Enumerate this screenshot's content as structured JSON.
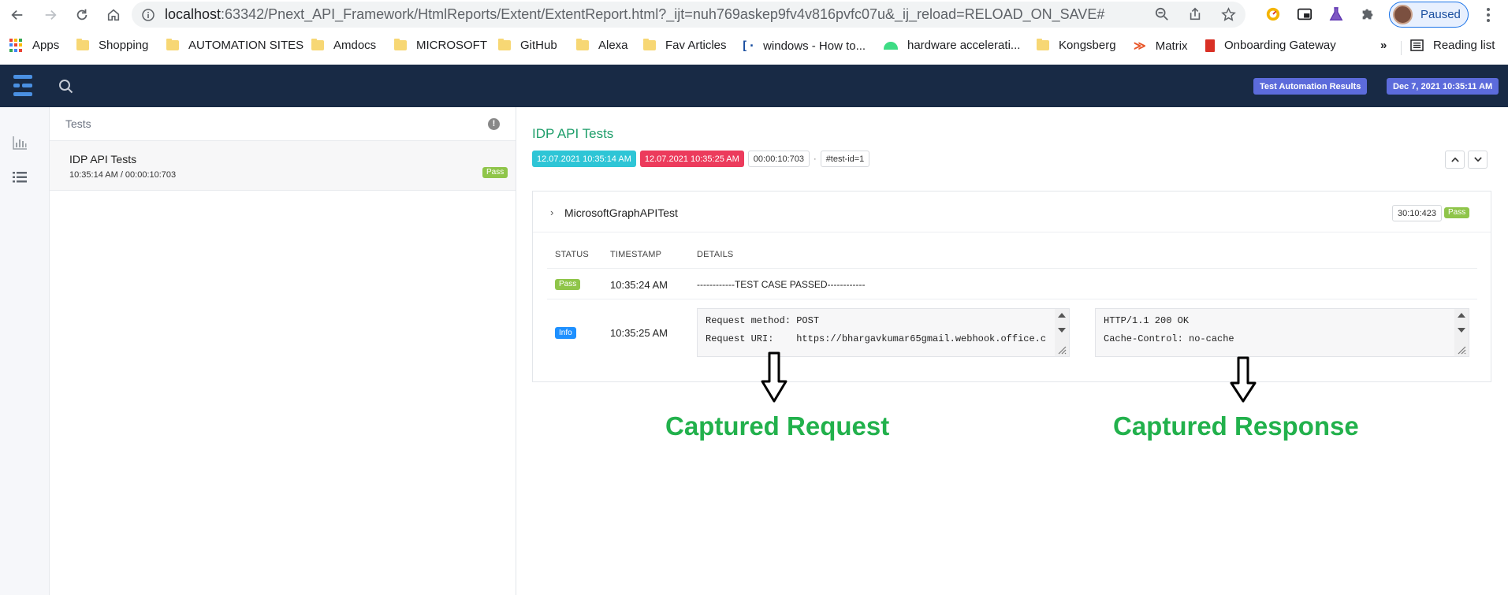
{
  "browser": {
    "url_host": "localhost",
    "url_rest": ":63342/Pnext_API_Framework/HtmlReports/Extent/ExtentReport.html?_ijt=nuh769askep9fv4v816pvfc07u&_ij_reload=RELOAD_ON_SAVE#",
    "profile_label": "Paused",
    "bookmarks": [
      "Apps",
      "Shopping",
      "AUTOMATION SITES",
      "Amdocs",
      "MICROSOFT",
      "GitHub",
      "Alexa",
      "Fav Articles",
      "windows - How to...",
      "hardware accelerati...",
      "Kongsberg",
      "Matrix",
      "Onboarding Gateway"
    ],
    "overflow": "»",
    "reading_list": "Reading list"
  },
  "header": {
    "report_badge": "Test Automation Results",
    "date_badge": "Dec 7, 2021 10:35:11 AM"
  },
  "tests_panel": {
    "heading": "Tests",
    "items": [
      {
        "name": "IDP API Tests",
        "meta": "10:35:14 AM / 00:00:10:703",
        "status": "Pass"
      }
    ]
  },
  "detail": {
    "title": "IDP API Tests",
    "start": "12.07.2021 10:35:14 AM",
    "end": "12.07.2021 10:35:25 AM",
    "duration": "00:00:10:703",
    "separator": "·",
    "test_id": "#test-id=1",
    "node": {
      "name": "MicrosoftGraphAPITest",
      "time": "30:10:423",
      "status": "Pass",
      "columns": [
        "STATUS",
        "TIMESTAMP",
        "DETAILS"
      ],
      "logs": [
        {
          "status": "Pass",
          "timestamp": "10:35:24 AM",
          "details": "------------TEST CASE PASSED------------"
        },
        {
          "status": "Info",
          "timestamp": "10:35:25 AM",
          "request": "Request method: POST\nRequest URI:    https://bhargavkumar65gmail.webhook.office.c",
          "response": "HTTP/1.1 200 OK\nCache-Control: no-cache"
        }
      ]
    }
  },
  "annotations": {
    "request_label": "Captured Request",
    "response_label": "Captured Response"
  },
  "colors": {
    "appbar": "#182a45",
    "title_green": "#1e9e6a",
    "pass": "#8fc54a",
    "info": "#1e90ff",
    "annotation": "#22b14c"
  }
}
